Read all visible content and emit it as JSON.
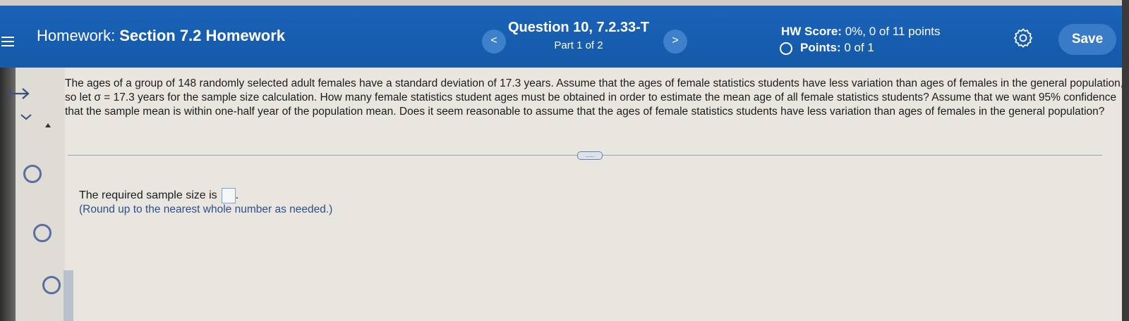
{
  "header": {
    "homework_label": "Homework:",
    "section": "Section 7.2 Homework",
    "question_title": "Question 10, 7.2.33-T",
    "part": "Part 1 of 2",
    "prev_label": "<",
    "next_label": ">",
    "hw_score_label": "HW Score:",
    "hw_score_value": "0%, 0 of 11 points",
    "points_label": "Points:",
    "points_value": "0 of 1",
    "save_label": "Save"
  },
  "question": {
    "lines": [
      "The ages of a group of 148 randomly selected adult females have a standard deviation of 17.3 years. Assume that the ages of female statistics students have less variation than ages of females in the general population,",
      "so let σ = 17.3 years for the sample size calculation. How many female statistics student ages must be obtained in order to estimate the mean age of all female statistics students? Assume that we want 95% confidence",
      "that the sample mean is within one-half year of the population mean. Does it seem reasonable to assume that the ages of female statistics students have less variation than ages of females in the general population?"
    ],
    "expand_label": "....."
  },
  "answer": {
    "prompt": "The required sample size is",
    "hint": "(Round up to the nearest whole number as needed.)"
  },
  "icons": {
    "menu": "hamburger-menu-icon",
    "settings": "gear-icon",
    "arrow": "arrow-right-bar-icon"
  },
  "colors": {
    "header_blue": "#1a63b8",
    "save_button": "#3a7bc8",
    "hint_text": "#2d4f8a"
  }
}
